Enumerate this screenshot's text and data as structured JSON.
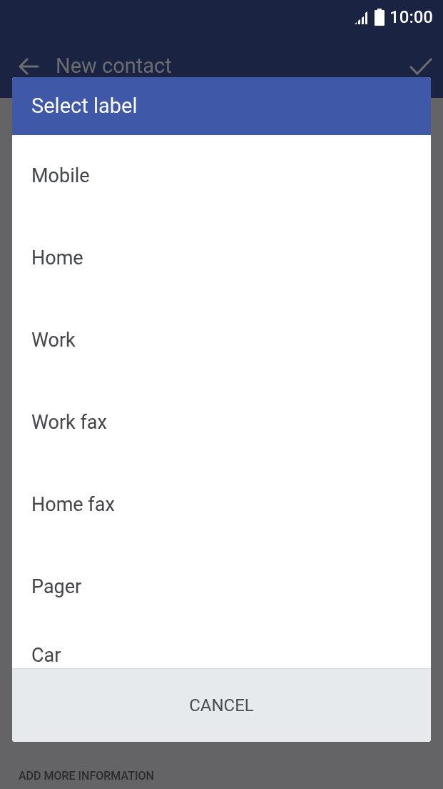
{
  "status_bar": {
    "time": "10:00"
  },
  "app_bar": {
    "title": "New contact"
  },
  "dialog": {
    "title": "Select label",
    "options": [
      {
        "label": "Mobile"
      },
      {
        "label": "Home"
      },
      {
        "label": "Work"
      },
      {
        "label": "Work fax"
      },
      {
        "label": "Home fax"
      },
      {
        "label": "Pager"
      },
      {
        "label": "Car"
      }
    ],
    "cancel_button": "CANCEL"
  },
  "section_header": "ADD MORE INFORMATION"
}
